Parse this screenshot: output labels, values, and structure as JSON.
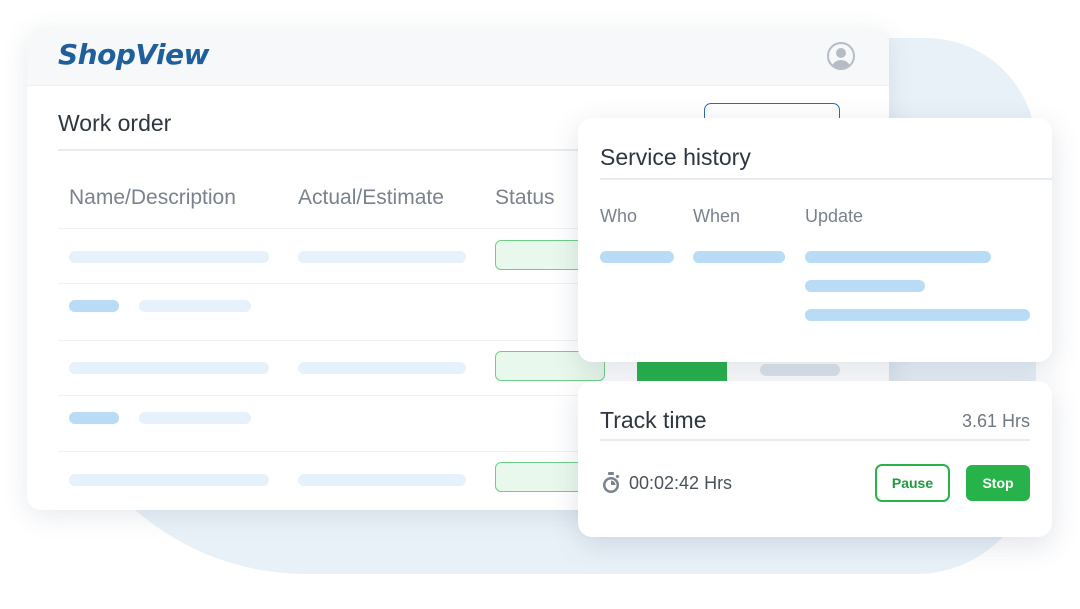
{
  "brand": {
    "logo_text": "ShopView",
    "accent": "#1f5f9c"
  },
  "header": {
    "avatar_icon": "user-circle-icon"
  },
  "work_order": {
    "title": "Work order",
    "columns": [
      "Name/Description",
      "Actual/Estimate",
      "Status"
    ]
  },
  "service_history": {
    "title": "Service history",
    "columns": [
      "Who",
      "When",
      "Update"
    ]
  },
  "track_time": {
    "title": "Track time",
    "total": "3.61 Hrs",
    "elapsed": "00:02:42 Hrs",
    "icon": "stopwatch-icon",
    "pause_label": "Pause",
    "stop_label": "Stop"
  },
  "colors": {
    "status_green": "#27b34a",
    "status_chip_border": "#6fcf87",
    "placeholder_light": "#e6f1fb",
    "placeholder_mid": "#b8dbf6"
  }
}
